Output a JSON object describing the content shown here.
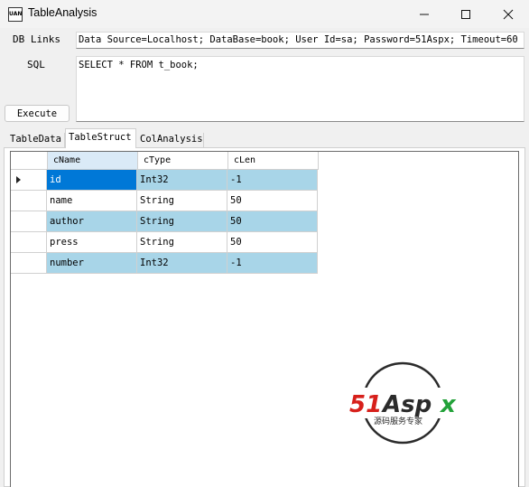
{
  "window": {
    "title": "TableAnalysis",
    "app_icon_text": "UAN",
    "minimize_icon": "minimize-icon",
    "maximize_icon": "maximize-icon",
    "close_icon": "close-icon"
  },
  "form": {
    "db_links_label": "DB Links",
    "db_links_value": "Data Source=Localhost; DataBase=book; User Id=sa; Password=51Aspx; Timeout=60",
    "sql_label": "SQL",
    "sql_value": "SELECT * FROM t_book;",
    "execute_label": "Execute"
  },
  "tabs": [
    {
      "label": "TableData",
      "active": false
    },
    {
      "label": "TableStruct",
      "active": true
    },
    {
      "label": "ColAnalysis",
      "active": false
    }
  ],
  "grid": {
    "columns": [
      "cName",
      "cType",
      "cLen"
    ],
    "selected_column": "cName",
    "current_row_indicator": "row-pointer-icon",
    "rows": [
      {
        "cName": "id",
        "cType": "Int32",
        "cLen": "-1"
      },
      {
        "cName": "name",
        "cType": "String",
        "cLen": "50"
      },
      {
        "cName": "author",
        "cType": "String",
        "cLen": "50"
      },
      {
        "cName": "press",
        "cType": "String",
        "cLen": "50"
      },
      {
        "cName": "number",
        "cType": "Int32",
        "cLen": "-1"
      }
    ]
  },
  "watermark": {
    "brand_text": "51Aspx",
    "tagline": "源码服务专家",
    "colors": {
      "red": "#d7201b",
      "green": "#23a23a",
      "dark": "#2b2b2b"
    }
  },
  "colors": {
    "selection": "#0078d7",
    "alternate_row": "#a8d5e8",
    "header_selected": "#daeaf7"
  }
}
